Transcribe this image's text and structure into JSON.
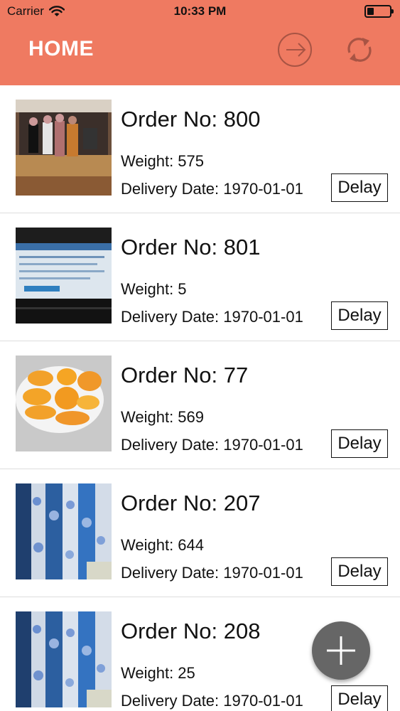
{
  "status_bar": {
    "carrier": "Carrier",
    "time": "10:33 PM"
  },
  "nav": {
    "title": "HOME",
    "logout_icon": "logout-icon",
    "refresh_icon": "refresh-icon"
  },
  "colors": {
    "header_bg": "#ef7a61",
    "fab_bg": "#666666"
  },
  "orders": [
    {
      "order_no": "Order No: 800",
      "weight": "Weight: 575",
      "delivery": "Delivery Date: 1970-01-01",
      "action": "Delay",
      "thumbnail": "group-photo"
    },
    {
      "order_no": "Order No: 801",
      "weight": "Weight: 5",
      "delivery": "Delivery Date: 1970-01-01",
      "action": "Delay",
      "thumbnail": "computer-screen-photo"
    },
    {
      "order_no": "Order No: 77",
      "weight": "Weight: 569",
      "delivery": "Delivery Date: 1970-01-01",
      "action": "Delay",
      "thumbnail": "orange-slices-photo"
    },
    {
      "order_no": "Order No: 207",
      "weight": "Weight: 644",
      "delivery": "Delivery Date: 1970-01-01",
      "action": "Delay",
      "thumbnail": "curtain-photo"
    },
    {
      "order_no": "Order No: 208",
      "weight": "Weight: 25",
      "delivery": "Delivery Date: 1970-01-01",
      "action": "Delay",
      "thumbnail": "curtain-photo"
    }
  ],
  "fab": {
    "icon": "plus-icon"
  }
}
